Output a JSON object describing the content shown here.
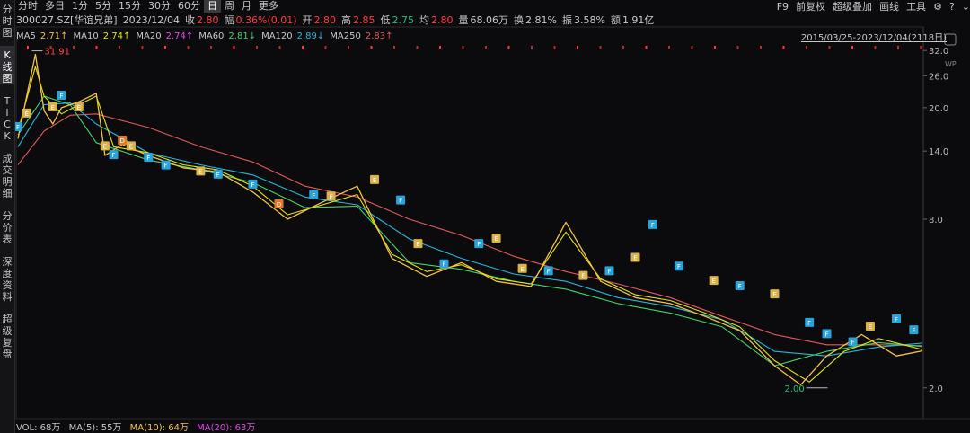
{
  "toolbar": {
    "timeframes": [
      "分时",
      "多日",
      "1分",
      "5分",
      "15分",
      "30分",
      "60分",
      "日",
      "周",
      "月",
      "更多"
    ],
    "active_timeframe": "日",
    "right_items": [
      "F9",
      "前复权",
      "超级叠加",
      "画线",
      "工具"
    ]
  },
  "side_tabs": [
    "分时图",
    "K线图",
    "TICK",
    "成交明细",
    "分价表",
    "深度资料",
    "超级复盘"
  ],
  "active_side_tab": "K线图",
  "quote": {
    "code_name": "300027.SZ[华谊兄弟]",
    "date": "2023/12/04",
    "close_label": "收",
    "close": "2.80",
    "change_label": "幅",
    "change": "0.36%(0.01)",
    "open_label": "开",
    "open": "2.80",
    "high_label": "高",
    "high": "2.85",
    "low_label": "低",
    "low": "2.75",
    "avg_label": "均",
    "avg": "2.80",
    "volume_label": "量",
    "volume": "68.06万",
    "turnover_label": "换",
    "turnover": "2.81%",
    "amplitude_label": "振",
    "amplitude": "3.58%",
    "amount_label": "额",
    "amount": "1.91亿"
  },
  "ma_legend": [
    {
      "name": "MA5",
      "value": "2.71↑",
      "color": "#f5c243"
    },
    {
      "name": "MA10",
      "value": "2.74↑",
      "color": "#e6e600"
    },
    {
      "name": "MA20",
      "value": "2.74↑",
      "color": "#e14be8"
    },
    {
      "name": "MA60",
      "value": "2.81↓",
      "color": "#3fd46a"
    },
    {
      "name": "MA120",
      "value": "2.89↓",
      "color": "#27b6d9"
    },
    {
      "name": "MA250",
      "value": "2.83↑",
      "color": "#e05a5a"
    }
  ],
  "date_range": "2015/03/25-2023/12/04(2118日)",
  "vol_legend": {
    "vol": "VOL: 68万",
    "ma5": "MA(5): 55万",
    "ma10": "MA(10): 64万",
    "ma20": "MA(20): 63万"
  },
  "chart_data": {
    "type": "line",
    "title": "",
    "xlabel": "",
    "ylabel": "",
    "ylim": [
      1.6,
      33.5
    ],
    "y_scale": "log",
    "yticks": [
      "32.0",
      "26.0",
      "20.0",
      "14.0",
      "8.0",
      "2.0"
    ],
    "yticks_values": [
      32,
      26,
      20,
      14,
      8,
      2
    ],
    "x_range": [
      "2015/03/25",
      "2023/12/04"
    ],
    "annotations": [
      {
        "text": "31.91",
        "x": "2015/06",
        "y": 31.91
      },
      {
        "text": "2.00",
        "x": "2022/10",
        "y": 2.0
      }
    ],
    "series": [
      {
        "color": "#e05a5a",
        "x": [
          "2015/04",
          "2015/07",
          "2015/10",
          "2016/01",
          "2016/07",
          "2017/01",
          "2017/07",
          "2018/01",
          "2018/07",
          "2019/01",
          "2019/07",
          "2020/01",
          "2020/07",
          "2021/01",
          "2021/07",
          "2022/01",
          "2022/07",
          "2023/01",
          "2023/07",
          "2023/12"
        ],
        "values": [
          12.5,
          16.5,
          18.8,
          19.0,
          17.0,
          14.5,
          12.8,
          10.5,
          9.6,
          8.0,
          7.0,
          5.9,
          5.2,
          4.7,
          4.2,
          3.6,
          3.1,
          2.85,
          2.85,
          2.83
        ]
      },
      {
        "color": "#27b6d9",
        "x": [
          "2015/04",
          "2015/07",
          "2015/10",
          "2016/01",
          "2016/07",
          "2017/01",
          "2017/07",
          "2018/01",
          "2018/07",
          "2019/01",
          "2019/07",
          "2020/01",
          "2020/07",
          "2021/01",
          "2021/07",
          "2022/01",
          "2022/07",
          "2023/01",
          "2023/07",
          "2023/12"
        ],
        "values": [
          14.5,
          20.5,
          20.8,
          17.5,
          13.8,
          12.5,
          11.5,
          9.6,
          9.0,
          6.8,
          5.8,
          5.1,
          4.8,
          4.2,
          3.9,
          3.5,
          2.7,
          2.6,
          2.8,
          2.89
        ]
      },
      {
        "color": "#3fd46a",
        "x": [
          "2015/04",
          "2015/07",
          "2015/10",
          "2016/01",
          "2016/07",
          "2017/01",
          "2017/07",
          "2018/01",
          "2018/07",
          "2019/01",
          "2019/07",
          "2020/01",
          "2020/07",
          "2021/01",
          "2021/07",
          "2022/01",
          "2022/07",
          "2023/01",
          "2023/07",
          "2023/12"
        ],
        "values": [
          16.0,
          22.0,
          20.5,
          15.0,
          13.0,
          12.0,
          10.8,
          8.8,
          8.9,
          5.6,
          5.3,
          4.8,
          4.5,
          4.0,
          3.7,
          3.3,
          2.4,
          2.7,
          2.9,
          2.81
        ]
      },
      {
        "color": "#e6e600",
        "x": [
          "2015/04",
          "2015/06",
          "2015/07",
          "2015/09",
          "2015/11",
          "2016/01",
          "2016/03",
          "2016/07",
          "2016/11",
          "2017/03",
          "2017/07",
          "2017/11",
          "2018/03",
          "2018/07",
          "2018/11",
          "2019/03",
          "2019/07",
          "2019/11",
          "2020/03",
          "2020/07",
          "2020/11",
          "2021/03",
          "2021/07",
          "2021/11",
          "2022/03",
          "2022/07",
          "2022/11",
          "2023/03",
          "2023/07",
          "2023/12"
        ],
        "values": [
          16.5,
          28.0,
          22.0,
          19.0,
          20.5,
          22.0,
          14.5,
          13.8,
          12.5,
          12.0,
          10.5,
          8.3,
          9.0,
          9.8,
          6.0,
          5.2,
          5.5,
          4.9,
          4.7,
          7.2,
          4.9,
          4.3,
          4.1,
          3.7,
          3.3,
          2.5,
          2.1,
          2.7,
          3.0,
          2.74
        ]
      },
      {
        "color": "#f5c243",
        "x": [
          "2015/04",
          "2015/05",
          "2015/06",
          "2015/07",
          "2015/08",
          "2015/09",
          "2015/11",
          "2016/01",
          "2016/02",
          "2016/04",
          "2016/07",
          "2016/11",
          "2017/03",
          "2017/07",
          "2017/11",
          "2018/03",
          "2018/07",
          "2018/11",
          "2019/03",
          "2019/07",
          "2019/11",
          "2020/03",
          "2020/07",
          "2020/11",
          "2021/03",
          "2021/07",
          "2021/11",
          "2022/03",
          "2022/07",
          "2022/10",
          "2023/01",
          "2023/05",
          "2023/09",
          "2023/12"
        ],
        "values": [
          15.5,
          22.0,
          31.0,
          19.5,
          17.5,
          20.0,
          21.0,
          22.5,
          13.5,
          14.8,
          13.5,
          12.2,
          11.8,
          10.0,
          8.0,
          9.2,
          10.5,
          5.8,
          5.0,
          5.6,
          4.8,
          4.6,
          7.8,
          4.8,
          4.2,
          4.0,
          3.6,
          3.2,
          2.4,
          2.05,
          2.6,
          3.1,
          2.6,
          2.71
        ]
      }
    ]
  }
}
